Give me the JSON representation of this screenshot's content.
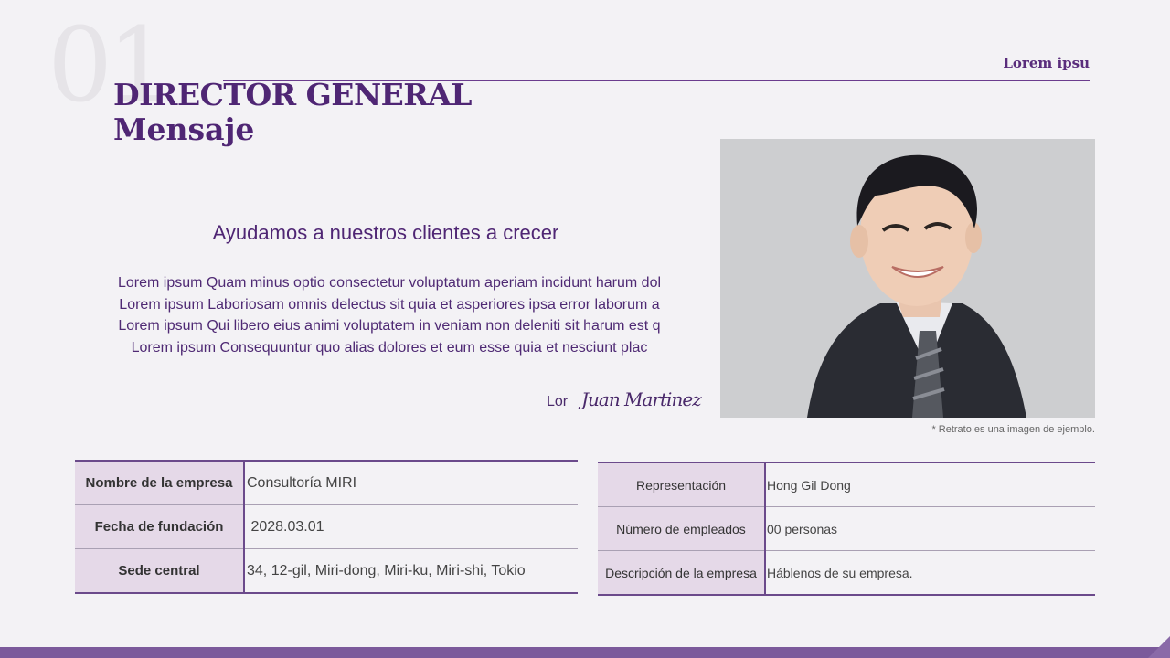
{
  "slide": {
    "number": "01",
    "brand": "Lorem ipsu",
    "title_line1": "DIRECTOR GENERAL",
    "title_line2": "Mensaje"
  },
  "message": {
    "headline": "Ayudamos a nuestros clientes a crecer",
    "paragraph_lines": [
      "Lorem ipsum Quam minus optio consectetur voluptatum aperiam incidunt harum dol",
      "Lorem ipsum Laboriosam omnis delectus sit quia et asperiores ipsa error laborum a",
      "Lorem ipsum Qui libero eius animi voluptatem in veniam non deleniti sit harum est q",
      "Lorem ipsum Consequuntur quo alias dolores et eum esse quia et nesciunt plac"
    ],
    "signature_prefix": "Lor",
    "signature": "Juan Martinez"
  },
  "photo": {
    "note": "* Retrato es una imagen de ejemplo."
  },
  "company_table": [
    {
      "label": "Nombre de la empresa",
      "value": "Consultoría MIRI"
    },
    {
      "label": "Fecha de fundación",
      "value": " 2028.03.01"
    },
    {
      "label": "Sede central",
      "value": "34, 12-gil, Miri-dong, Miri-ku, Miri-shi, Tokio"
    }
  ],
  "details_table": [
    {
      "label": "Representación",
      "value": "Hong Gil Dong"
    },
    {
      "label": "Número de empleados",
      "value": "00 personas"
    },
    {
      "label": "Descripción de la empresa",
      "value": "Háblenos de su empresa."
    }
  ],
  "colors": {
    "accent": "#4f2674",
    "table_label_bg": "#e5d9e8",
    "bottom_bar": "#7b5a9b"
  }
}
